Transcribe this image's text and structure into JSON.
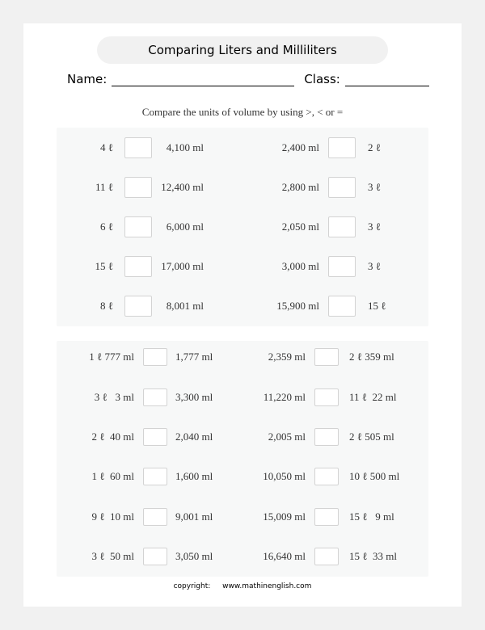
{
  "worksheet": {
    "title": "Comparing Liters and Milliliters",
    "name_label": "Name:",
    "class_label": "Class:",
    "instructions": "Compare the units of volume by using >, < or ="
  },
  "section1": {
    "rows": [
      {
        "left": {
          "lhs": "4 ℓ",
          "rhs": "4,100 ml"
        },
        "right": {
          "lhs": "2,400 ml",
          "rhs": "2 ℓ"
        }
      },
      {
        "left": {
          "lhs": "11 ℓ",
          "rhs": "12,400 ml"
        },
        "right": {
          "lhs": "2,800 ml",
          "rhs": "3 ℓ"
        }
      },
      {
        "left": {
          "lhs": "6 ℓ",
          "rhs": "6,000 ml"
        },
        "right": {
          "lhs": "2,050 ml",
          "rhs": "3 ℓ"
        }
      },
      {
        "left": {
          "lhs": "15 ℓ",
          "rhs": "17,000 ml"
        },
        "right": {
          "lhs": "3,000 ml",
          "rhs": "3 ℓ"
        }
      },
      {
        "left": {
          "lhs": "8 ℓ",
          "rhs": "8,001 ml"
        },
        "right": {
          "lhs": "15,900 ml",
          "rhs": "15 ℓ"
        }
      }
    ]
  },
  "section2": {
    "rows": [
      {
        "left": {
          "lhs": "1 ℓ 777 ml",
          "rhs": "1,777 ml"
        },
        "right": {
          "lhs": "2,359 ml",
          "rhs": "2 ℓ 359 ml"
        }
      },
      {
        "left": {
          "lhs": "3 ℓ   3 ml",
          "rhs": "3,300 ml"
        },
        "right": {
          "lhs": "11,220 ml",
          "rhs": "11 ℓ  22 ml"
        }
      },
      {
        "left": {
          "lhs": "2 ℓ  40 ml",
          "rhs": "2,040 ml"
        },
        "right": {
          "lhs": "2,005 ml",
          "rhs": "2 ℓ 505 ml"
        }
      },
      {
        "left": {
          "lhs": "1 ℓ  60 ml",
          "rhs": "1,600 ml"
        },
        "right": {
          "lhs": "10,050 ml",
          "rhs": "10 ℓ 500 ml"
        }
      },
      {
        "left": {
          "lhs": "9 ℓ  10 ml",
          "rhs": "9,001 ml"
        },
        "right": {
          "lhs": "15,009 ml",
          "rhs": "15 ℓ   9 ml"
        }
      },
      {
        "left": {
          "lhs": "3 ℓ  50 ml",
          "rhs": "3,050 ml"
        },
        "right": {
          "lhs": "16,640 ml",
          "rhs": "15 ℓ  33 ml"
        }
      }
    ]
  },
  "footer": {
    "copyright_label": "copyright:",
    "website": "www.mathinenglish.com"
  }
}
